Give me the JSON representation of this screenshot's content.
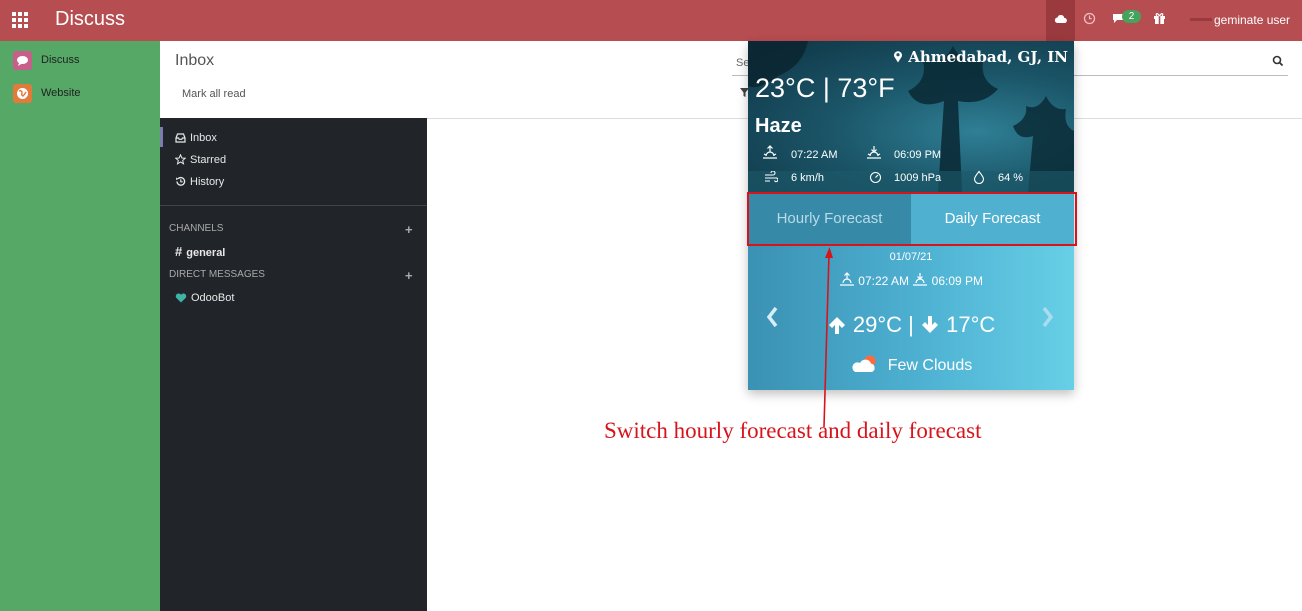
{
  "topbar": {
    "app_title": "Discuss",
    "chat_badge": "2",
    "user_name": "geminate user",
    "color": "#b64d51"
  },
  "apps": [
    {
      "label": "Discuss",
      "icon": "chat-bubble-icon",
      "color": "#c75f8a"
    },
    {
      "label": "Website",
      "icon": "globe-icon",
      "color": "#e07b3c"
    }
  ],
  "control_panel": {
    "title": "Inbox",
    "mark_all_read": "Mark all read",
    "search_placeholder": "Se"
  },
  "discuss": {
    "mailboxes": [
      {
        "label": "Inbox",
        "icon": "inbox-icon",
        "active": true
      },
      {
        "label": "Starred",
        "icon": "star-icon"
      },
      {
        "label": "History",
        "icon": "history-icon"
      }
    ],
    "channels_header": "CHANNELS",
    "channels": [
      {
        "label": "general",
        "prefix": "#"
      }
    ],
    "dm_header": "DIRECT MESSAGES",
    "direct_messages": [
      {
        "label": "OdooBot",
        "icon": "heart-icon"
      }
    ]
  },
  "weather": {
    "location": "Ahmedabad, GJ, IN",
    "temperature": "23°C | 73°F",
    "condition": "Haze",
    "sunrise": "07:22 AM",
    "sunset": "06:09 PM",
    "wind": "6 km/h",
    "pressure": "1009 hPa",
    "humidity": "64 %",
    "tabs": {
      "hourly": "Hourly Forecast",
      "daily": "Daily Forecast",
      "active": "daily"
    },
    "forecast": {
      "date": "01/07/21",
      "sunrise": "07:22 AM",
      "sunset": "06:09 PM",
      "max": "29°C",
      "min": "17°C",
      "description": "Few Clouds"
    }
  },
  "annotation": {
    "text": "Switch hourly forecast and daily forecast",
    "color": "#d7141c"
  }
}
